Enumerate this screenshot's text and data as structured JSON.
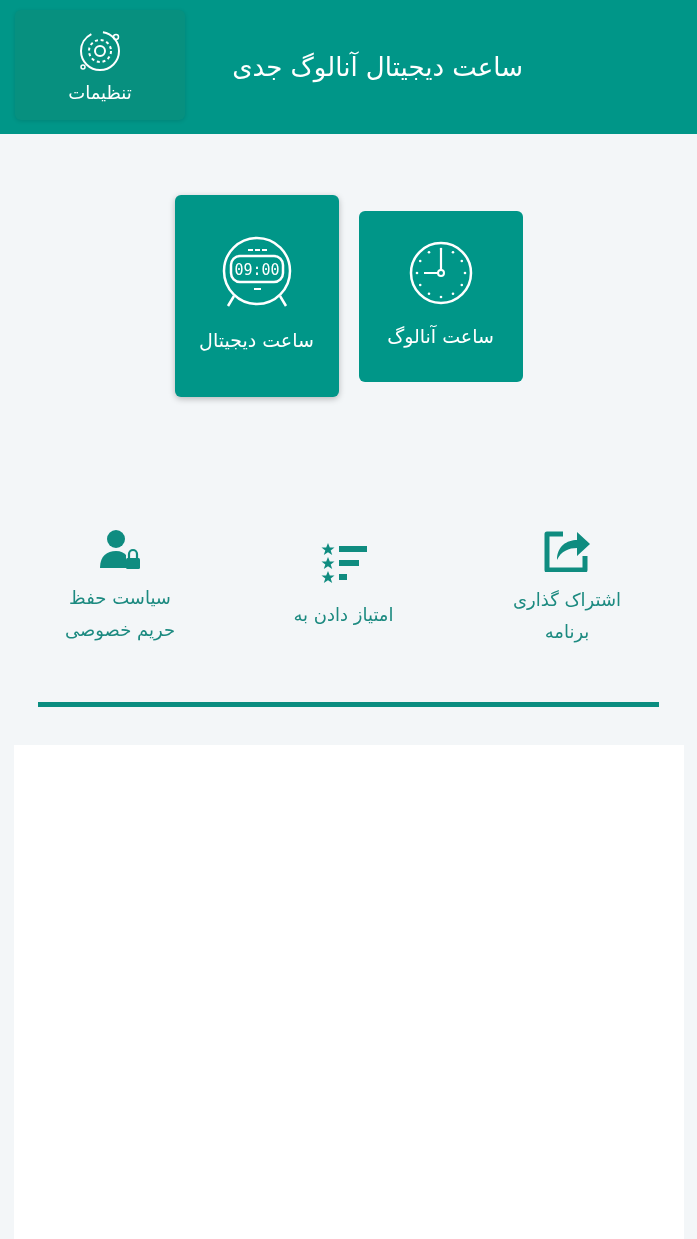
{
  "app_bar": {
    "title": "ساعت دیجیتال آنالوگ جدی",
    "settings_label": "تنظیمات"
  },
  "clock_cards": [
    {
      "kind": "analog",
      "label": "ساعت آنالوگ",
      "selected": false
    },
    {
      "kind": "digital",
      "label": "ساعت دیجیتال",
      "time": "09:00",
      "selected": true
    }
  ],
  "actions": [
    {
      "kind": "share",
      "label": "اشتراک گذاری برنامه"
    },
    {
      "kind": "rate",
      "label": "امتیاز دادن به"
    },
    {
      "kind": "privacy",
      "label": "سیاست حفظ حریم خصوصی"
    }
  ]
}
